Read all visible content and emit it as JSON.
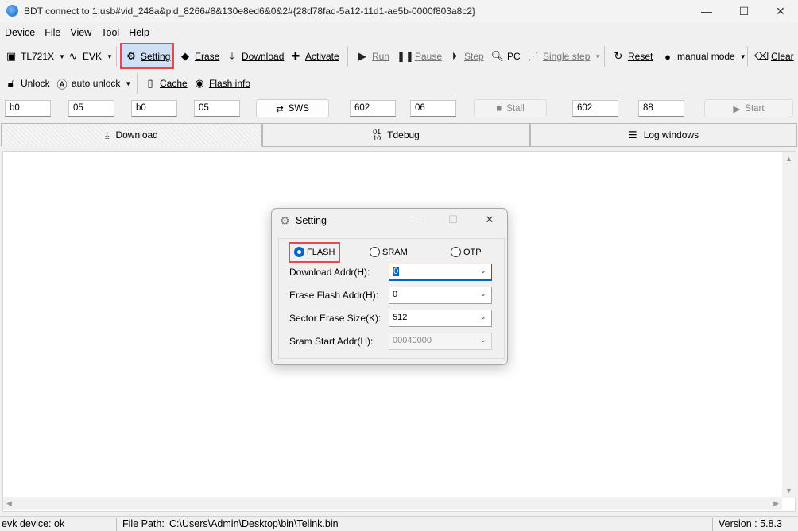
{
  "window": {
    "title": "BDT connect to 1:usb#vid_248a&pid_8266#8&130e8ed6&0&2#{28d78fad-5a12-11d1-ae5b-0000f803a8c2}",
    "controls": [
      "—",
      "☐",
      "✕"
    ]
  },
  "menu": [
    "Device",
    "File",
    "View",
    "Tool",
    "Help"
  ],
  "toolbar1": {
    "chip": "TL721X",
    "board": "EVK",
    "setting": "Setting",
    "erase": "Erase",
    "download": "Download",
    "activate": "Activate",
    "run": "Run",
    "pause": "Pause",
    "step": "Step",
    "pc": "PC",
    "single_step": "Single step",
    "reset": "Reset",
    "mode": "manual mode",
    "clear": "Clear"
  },
  "toolbar2": {
    "unlock": "Unlock",
    "auto_unlock": "auto unlock",
    "cache": "Cache",
    "flash_info": "Flash info"
  },
  "regs": {
    "f1": "b0",
    "f2": "05",
    "f3": "b0",
    "f4": "05",
    "sws": "SWS",
    "f5": "602",
    "f6": "06",
    "stall": "Stall",
    "f7": "602",
    "f8": "88",
    "start": "Start"
  },
  "tabs": [
    "Download",
    "Tdebug",
    "Log windows"
  ],
  "status": {
    "device": "evk device: ok",
    "path_label": "File Path:",
    "path": "C:\\Users\\Admin\\Desktop\\bin\\Telink.bin",
    "version": "Version : 5.8.3"
  },
  "dialog": {
    "title": "Setting",
    "radios": [
      "FLASH",
      "SRAM",
      "OTP"
    ],
    "selected": "FLASH",
    "rows": [
      {
        "label": "Download  Addr(H):",
        "value": "0"
      },
      {
        "label": "Erase Flash Addr(H):",
        "value": "0"
      },
      {
        "label": "Sector Erase Size(K):",
        "value": "512"
      },
      {
        "label": "Sram Start Addr(H):",
        "value": "00040000"
      }
    ]
  },
  "colors": {
    "highlight": "#e5484d",
    "accent": "#0067c0"
  }
}
